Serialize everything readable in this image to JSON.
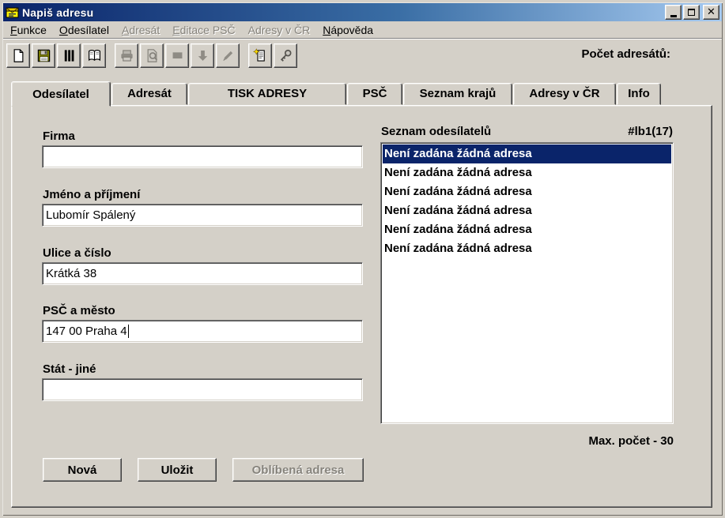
{
  "window": {
    "title": "Napiš adresu",
    "controls": [
      "minimize-icon",
      "maximize-icon",
      "close-icon"
    ]
  },
  "menu": {
    "items": [
      {
        "label": "Funkce",
        "enabled": true
      },
      {
        "label": "Odesílatel",
        "enabled": true
      },
      {
        "label": "Adresát",
        "enabled": false
      },
      {
        "label": "Editace PSČ",
        "enabled": false
      },
      {
        "label": "Adresy v ČR",
        "enabled": false
      },
      {
        "label": "Nápověda",
        "enabled": true
      }
    ]
  },
  "toolbar": {
    "count_label": "Počet adresátů:",
    "buttons": [
      {
        "icon": "new-document-icon",
        "enabled": true
      },
      {
        "icon": "save-icon",
        "enabled": true
      },
      {
        "icon": "columns-icon",
        "enabled": true
      },
      {
        "icon": "book-icon",
        "enabled": true
      },
      {
        "icon": "print-icon",
        "enabled": false
      },
      {
        "icon": "print-preview-icon",
        "enabled": false
      },
      {
        "icon": "stop-icon",
        "enabled": false
      },
      {
        "icon": "download-arrow-icon",
        "enabled": false
      },
      {
        "icon": "pencil-icon",
        "enabled": false
      },
      {
        "icon": "new-note-icon",
        "enabled": true
      },
      {
        "icon": "key-icon",
        "enabled": true
      }
    ]
  },
  "tabs": [
    {
      "label": "Odesílatel",
      "active": true
    },
    {
      "label": "Adresát",
      "active": false
    },
    {
      "label": "TISK ADRESY",
      "active": false
    },
    {
      "label": "PSČ",
      "active": false
    },
    {
      "label": "Seznam krajů",
      "active": false
    },
    {
      "label": "Adresy v ČR",
      "active": false
    },
    {
      "label": "Info",
      "active": false
    }
  ],
  "form": {
    "fields": [
      {
        "label": "Firma",
        "value": ""
      },
      {
        "label": "Jméno a příjmení",
        "value": "Lubomír Spálený"
      },
      {
        "label": "Ulice a číslo",
        "value": "Krátká 38"
      },
      {
        "label": "PSČ a město",
        "value": "147 00 Praha 4"
      },
      {
        "label": "Stát - jiné",
        "value": ""
      }
    ],
    "buttons": [
      {
        "label": "Nová",
        "enabled": true
      },
      {
        "label": "Uložit",
        "enabled": true
      },
      {
        "label": "Oblíbená adresa",
        "enabled": false
      }
    ]
  },
  "sender_list": {
    "title": "Seznam odesílatelů",
    "badge": "#lb1(17)",
    "selected_index": 0,
    "items": [
      "Není zadána žádná adresa",
      "Není zadána žádná adresa",
      "Není zadána žádná adresa",
      "Není zadána žádná adresa",
      "Není zadána žádná adresa",
      "Není zadána žádná adresa"
    ],
    "max_note": "Max. počet - 30"
  },
  "colors": {
    "window_bg": "#D4D0C8",
    "titlebar_start": "#0A246A",
    "titlebar_end": "#A6CAF0",
    "selection": "#0A246A",
    "disabled_text": "#86837C"
  }
}
